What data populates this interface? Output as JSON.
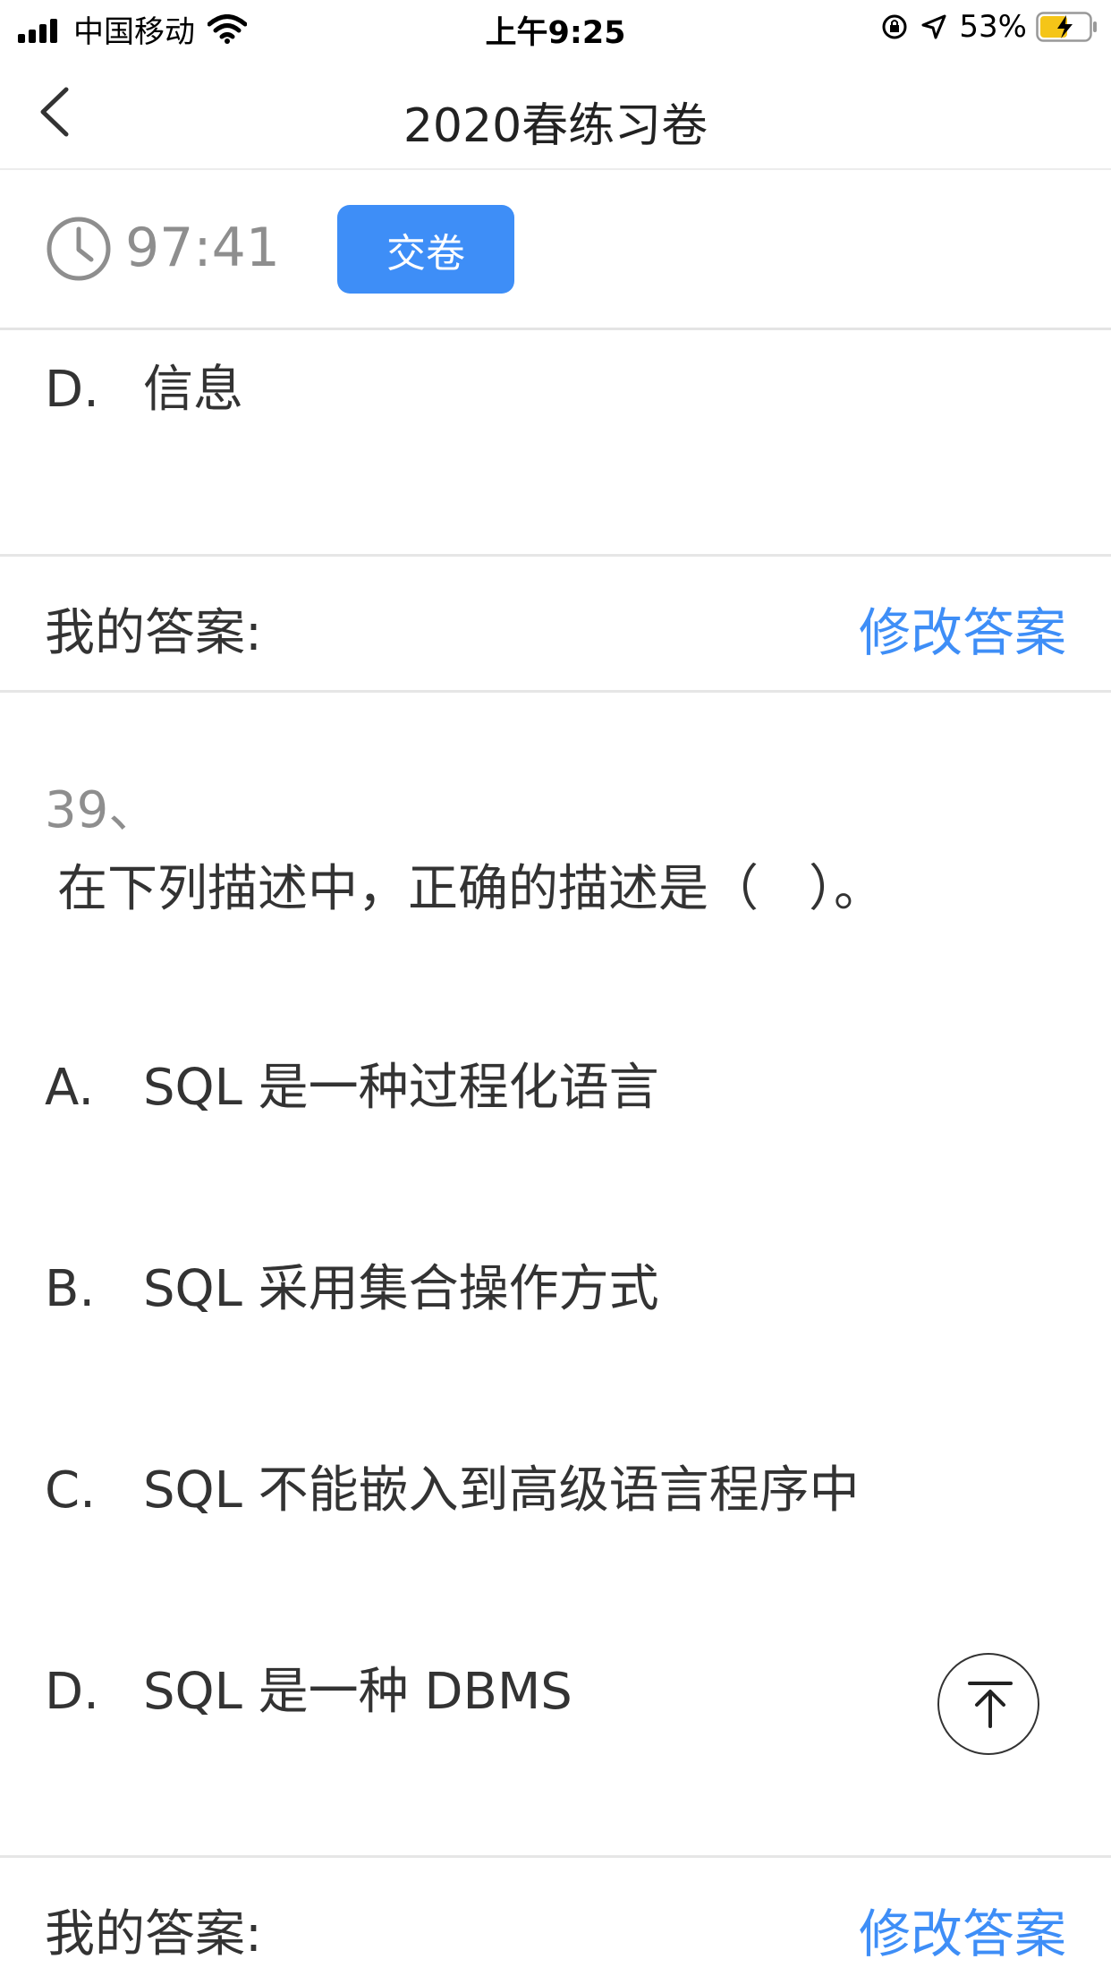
{
  "status_bar": {
    "carrier": "中国移动",
    "time": "上午9:25",
    "battery_percent": "53%"
  },
  "nav": {
    "title": "2020春练习卷"
  },
  "timer": {
    "remaining": "97:41",
    "submit_label": "交卷"
  },
  "previous_question": {
    "option_d": {
      "letter": "D.",
      "text": "信息"
    },
    "answer_label": "我的答案:",
    "modify_label": "修改答案"
  },
  "question": {
    "number": "39、",
    "text": "在下列描述中，正确的描述是（　）。",
    "options": [
      {
        "letter": "A.",
        "text": "SQL 是一种过程化语言"
      },
      {
        "letter": "B.",
        "text": "SQL 采用集合操作方式"
      },
      {
        "letter": "C.",
        "text": "SQL 不能嵌入到高级语言程序中"
      },
      {
        "letter": "D.",
        "text": "SQL 是一种 DBMS"
      }
    ],
    "answer_label": "我的答案:",
    "modify_label": "修改答案"
  },
  "icons": {
    "back": "chevron-left-icon",
    "clock": "clock-icon",
    "back_to_top": "arrow-up-to-top-icon"
  },
  "colors": {
    "accent": "#3e8ef7",
    "muted": "#8e8e8e"
  }
}
